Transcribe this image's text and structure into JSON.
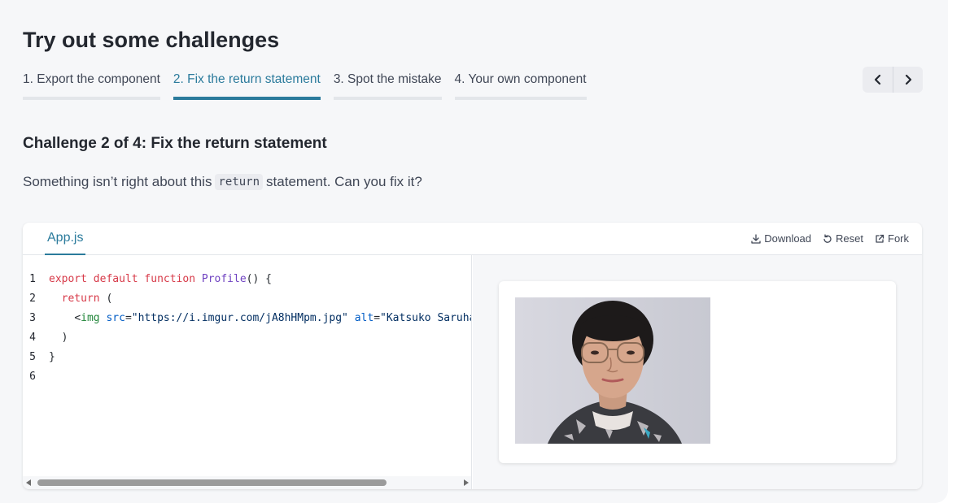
{
  "page": {
    "title": "Try out some challenges"
  },
  "tabs": [
    {
      "label": "1. Export the component",
      "active": false
    },
    {
      "label": "2. Fix the return statement",
      "active": true
    },
    {
      "label": "3. Spot the mistake",
      "active": false
    },
    {
      "label": "4. Your own component",
      "active": false
    }
  ],
  "nav": {
    "prev_icon": "chevron-left-icon",
    "next_icon": "chevron-right-icon"
  },
  "challenge": {
    "prefix": "Challenge 2 of 4:",
    "title": "Fix the return statement",
    "desc_before": "Something isn’t right about this",
    "desc_code": "return",
    "desc_after": "statement. Can you fix it?"
  },
  "sandbox": {
    "file_tab": "App.js",
    "actions": {
      "download": "Download",
      "reset": "Reset",
      "fork": "Fork"
    },
    "code": {
      "line_numbers": [
        "1",
        "2",
        "3",
        "4",
        "5",
        "6"
      ],
      "line1": {
        "kw1": "export",
        "kw2": "default",
        "kw3": "function",
        "fn": "Profile",
        "rest": "() {"
      },
      "line2": {
        "kw": "return",
        "rest": " ("
      },
      "line3": {
        "open": "<",
        "tag": "img",
        "attr1": "src",
        "eq1": "=",
        "val1": "\"https://i.imgur.com/jA8hHMpm.jpg\"",
        "attr2": "alt",
        "eq2": "=",
        "val2": "\"Katsuko Saruhashi\""
      },
      "line4": {
        "text": ")"
      },
      "line5": {
        "text": "}"
      }
    },
    "preview": {
      "image_alt": "Katsuko Saruhashi"
    }
  },
  "colors": {
    "accent": "#2b7b9c",
    "keyword": "#d73a49",
    "function": "#6f42c1",
    "tag": "#22863a",
    "attr": "#005cc5",
    "string": "#032f62"
  }
}
